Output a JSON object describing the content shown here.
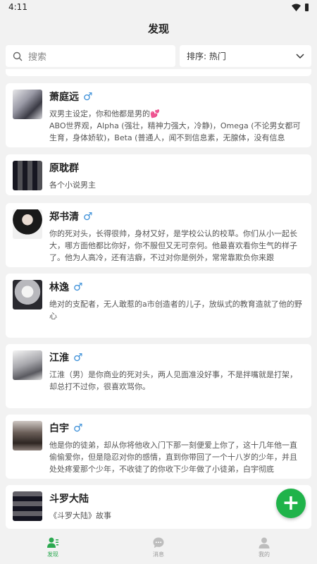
{
  "status_bar": {
    "time": "4:11"
  },
  "header": {
    "title": "发现"
  },
  "search": {
    "placeholder": "搜索"
  },
  "sort": {
    "label": "排序: 热门"
  },
  "characters": [
    {
      "name": "萧庭远",
      "gender": "♂",
      "description": "双男主设定，你和他都是男的💕\nABO世界观，Alpha (强壮，精神力强大，冷静)，Omega (不论男女都可生育，身体娇软)，Beta (普通人，闻不到信息素，无腺体，没有信息"
    },
    {
      "name": "原耽群",
      "gender": "",
      "description": "各个小说男主"
    },
    {
      "name": "郑书清",
      "gender": "♂",
      "description": "你的死对头，长得很帅，身材又好，是学校公认的校草。你们从小一起长大，哪方面他都比你好，你不服但又无可奈何。他最喜欢看你生气的样子了。他为人高冷，还有洁癖，不过对你是例外，常常靠欺负你来跟"
    },
    {
      "name": "林逸",
      "gender": "♂",
      "description": "绝对的支配者，无人敢惹的a市创造者的儿子，放纵式的教育造就了他的野心"
    },
    {
      "name": "江淮",
      "gender": "♂",
      "description": "江淮（男）是你商业的死对头，两人见面准没好事，不是拌嘴就是打架，却总打不过你，很喜欢骂你。"
    },
    {
      "name": "白宇",
      "gender": "♂",
      "description": "他是你的徒弟，却从你将他收入门下那一刻便爱上你了，这十几年他一直偷偷爱你，但是隐忍对你的感情，直到你带回了一个十八岁的少年，并且处处疼爱那个少年，不收徒了的你收下少年做了小徒弟，白宇彻底"
    },
    {
      "name": "斗罗大陆",
      "gender": "",
      "description": "《斗罗大陆》故事"
    }
  ],
  "fab": {
    "label": "+"
  },
  "tabs": [
    {
      "label": "发现",
      "icon": "discover-icon",
      "active": true
    },
    {
      "label": "消息",
      "icon": "chat-bubble-icon",
      "active": false
    },
    {
      "label": "我的",
      "icon": "person-icon",
      "active": false
    }
  ],
  "colors": {
    "accent": "#20b34a",
    "male_symbol": "#3b8fd8",
    "background": "#f2f2f2"
  }
}
